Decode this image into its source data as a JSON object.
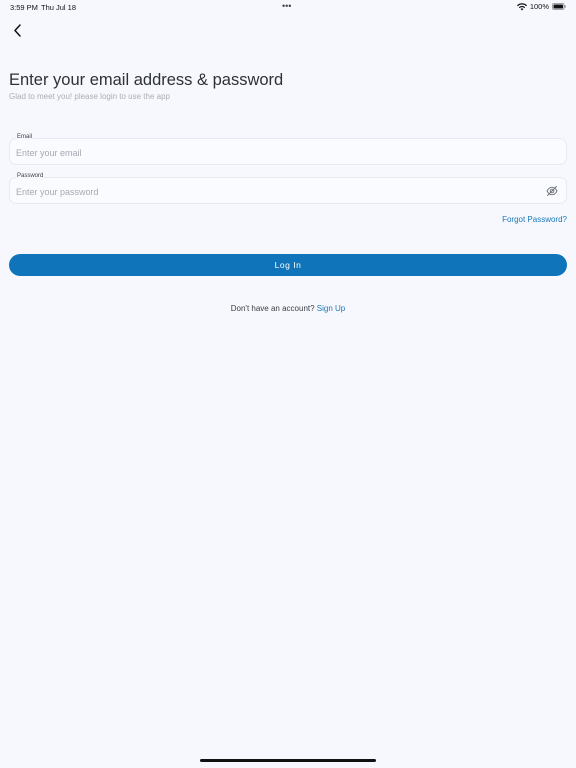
{
  "status_bar": {
    "time": "3:59 PM",
    "date": "Thu Jul 18",
    "dots": "•••",
    "battery": "100%"
  },
  "icons": {
    "back": "chevron-left-icon",
    "visibility": "eye-off-icon",
    "wifi": "wifi-icon",
    "battery": "battery-icon"
  },
  "header": {
    "title": "Enter your email address & password",
    "subtitle": "Glad to meet you! please login to use the app"
  },
  "form": {
    "email": {
      "label": "Email",
      "placeholder": "Enter your email",
      "value": ""
    },
    "password": {
      "label": "Password",
      "placeholder": "Enter your password",
      "value": ""
    },
    "forgot_label": "Forgot Password?",
    "login_label": "Log In"
  },
  "footer": {
    "prompt": "Don't have an account?",
    "signup_label": "Sign Up"
  },
  "colors": {
    "background": "#f6f8fd",
    "primary": "#0f74ba",
    "link": "#1a78b8"
  }
}
